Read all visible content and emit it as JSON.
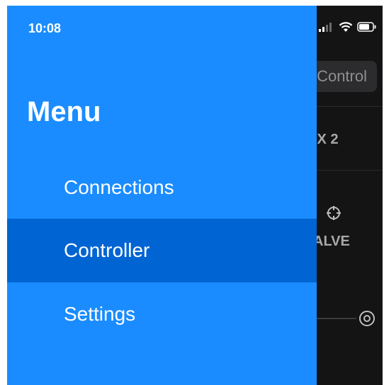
{
  "status_bar": {
    "time": "10:08"
  },
  "menu": {
    "title": "Menu",
    "items": [
      {
        "label": "Connections",
        "active": false
      },
      {
        "label": "Controller",
        "active": true
      },
      {
        "label": "Settings",
        "active": false
      }
    ]
  },
  "background_app": {
    "control_button_label": "Control",
    "aux_label": "IX 2",
    "valve_label": "ALVE"
  },
  "colors": {
    "menu_bg": "#1a8cff",
    "menu_active_bg": "#0064d2",
    "background_app": "#141414"
  },
  "icons": {
    "signal": "signal-icon",
    "wifi": "wifi-icon",
    "battery": "battery-icon",
    "crosshair": "crosshair-icon",
    "target": "target-icon"
  }
}
